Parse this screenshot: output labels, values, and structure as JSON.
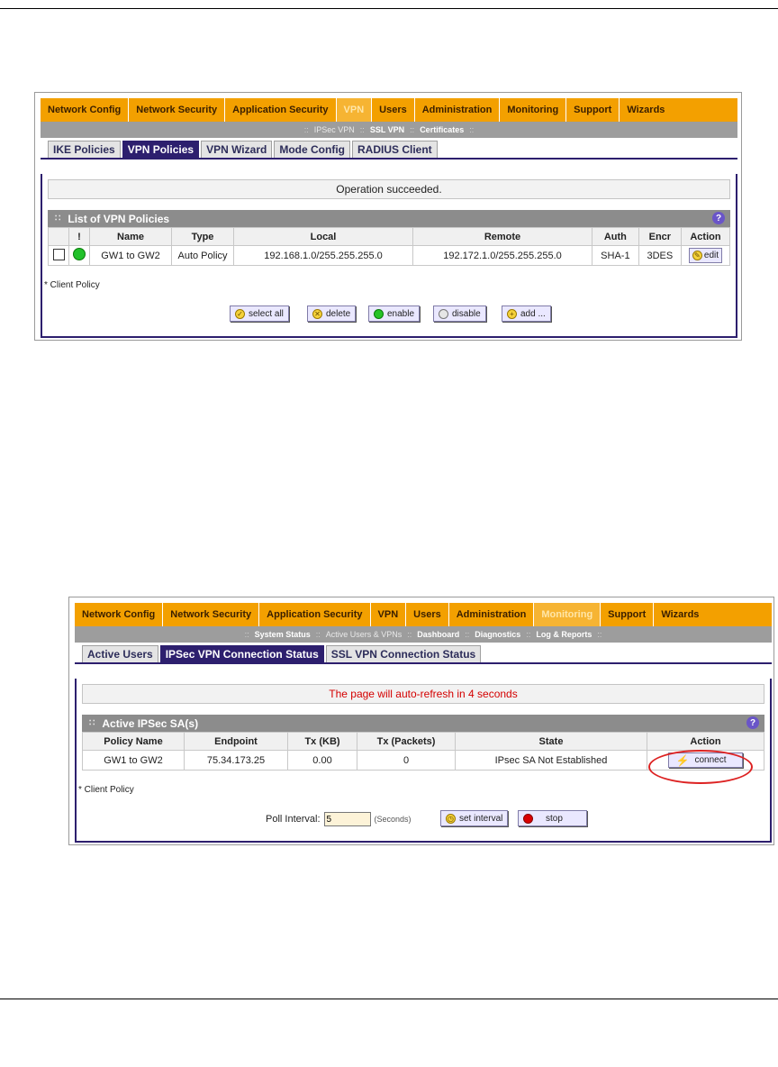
{
  "shot1": {
    "topnav": [
      {
        "label": "Network Config",
        "active": false
      },
      {
        "label": "Network Security",
        "active": false
      },
      {
        "label": "Application Security",
        "active": false
      },
      {
        "label": "VPN",
        "active": true
      },
      {
        "label": "Users",
        "active": false
      },
      {
        "label": "Administration",
        "active": false
      },
      {
        "label": "Monitoring",
        "active": false
      },
      {
        "label": "Support",
        "active": false
      },
      {
        "label": "Wizards",
        "active": false
      }
    ],
    "subnav": [
      {
        "label": "IPSec VPN",
        "current": true
      },
      {
        "label": "SSL VPN",
        "current": false
      },
      {
        "label": "Certificates",
        "current": false
      }
    ],
    "tabs": [
      {
        "label": "IKE Policies",
        "active": false
      },
      {
        "label": "VPN Policies",
        "active": true
      },
      {
        "label": "VPN Wizard",
        "active": false
      },
      {
        "label": "Mode Config",
        "active": false
      },
      {
        "label": "RADIUS Client",
        "active": false
      }
    ],
    "message": "Operation succeeded.",
    "section_title": "List of VPN Policies",
    "help_symbol": "?",
    "columns": [
      "",
      "!",
      "Name",
      "Type",
      "Local",
      "Remote",
      "Auth",
      "Encr",
      "Action"
    ],
    "rows": [
      {
        "name": "GW1 to GW2",
        "type": "Auto Policy",
        "local": "192.168.1.0/255.255.255.0",
        "remote": "192.172.1.0/255.255.255.0",
        "auth": "SHA-1",
        "encr": "3DES",
        "action": "edit"
      }
    ],
    "note": "* Client Policy",
    "buttons": {
      "select_all": "select all",
      "delete": "delete",
      "enable": "enable",
      "disable": "disable",
      "add": "add ..."
    }
  },
  "shot2": {
    "topnav": [
      {
        "label": "Network Config",
        "active": false
      },
      {
        "label": "Network Security",
        "active": false
      },
      {
        "label": "Application Security",
        "active": false
      },
      {
        "label": "VPN",
        "active": false
      },
      {
        "label": "Users",
        "active": false
      },
      {
        "label": "Administration",
        "active": false
      },
      {
        "label": "Monitoring",
        "active": true
      },
      {
        "label": "Support",
        "active": false
      },
      {
        "label": "Wizards",
        "active": false
      }
    ],
    "subnav": [
      {
        "label": "System Status",
        "current": false
      },
      {
        "label": "Active Users & VPNs",
        "current": true
      },
      {
        "label": "Dashboard",
        "current": false
      },
      {
        "label": "Diagnostics",
        "current": false
      },
      {
        "label": "Log & Reports",
        "current": false
      }
    ],
    "tabs": [
      {
        "label": "Active Users",
        "active": false
      },
      {
        "label": "IPSec VPN Connection Status",
        "active": true
      },
      {
        "label": "SSL VPN Connection Status",
        "active": false
      }
    ],
    "message": "The page will auto-refresh in 4 seconds",
    "message_color": "#d40000",
    "section_title": "Active IPSec SA(s)",
    "help_symbol": "?",
    "columns": [
      "Policy Name",
      "Endpoint",
      "Tx (KB)",
      "Tx (Packets)",
      "State",
      "Action"
    ],
    "rows": [
      {
        "policy": "GW1 to GW2",
        "endpoint": "75.34.173.25",
        "tx_kb": "0.00",
        "tx_packets": "0",
        "state": "IPsec SA Not Established",
        "action": "connect"
      }
    ],
    "note": "* Client Policy",
    "poll_label": "Poll Interval:",
    "poll_value": "5",
    "poll_unit": "(Seconds)",
    "buttons": {
      "set_interval": "set interval",
      "stop": "stop"
    }
  },
  "colors": {
    "brand_orange": "#f3a000",
    "tab_navy": "#2d1f6e",
    "highlight_red": "#d22222"
  }
}
